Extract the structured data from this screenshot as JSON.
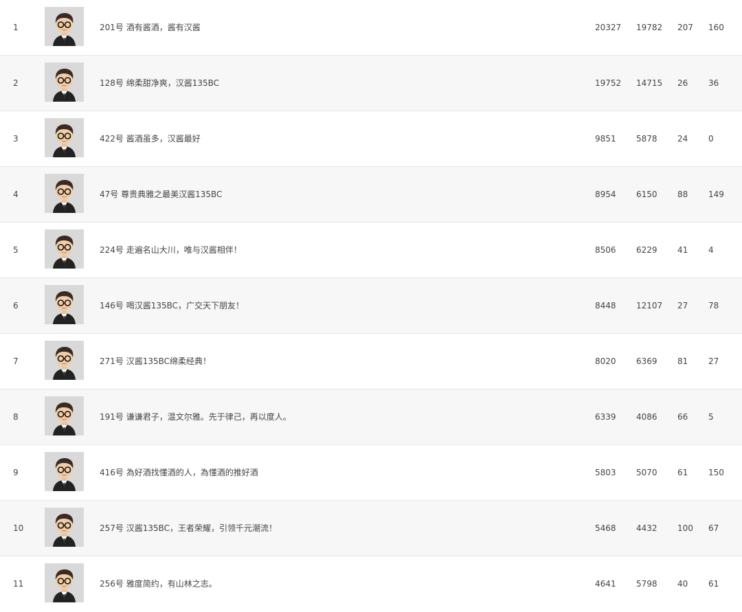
{
  "rows": [
    {
      "rank": "1",
      "title": "201号 酒有酱酒，酱有汉酱",
      "c1": "20327",
      "c2": "19782",
      "c3": "207",
      "c4": "160"
    },
    {
      "rank": "2",
      "title": "128号 绵柔甜净爽，汉酱135BC",
      "c1": "19752",
      "c2": "14715",
      "c3": "26",
      "c4": "36"
    },
    {
      "rank": "3",
      "title": "422号 酱酒虽多，汉酱最好",
      "c1": "9851",
      "c2": "5878",
      "c3": "24",
      "c4": "0"
    },
    {
      "rank": "4",
      "title": "47号 尊贵典雅之最美汉酱135BC",
      "c1": "8954",
      "c2": "6150",
      "c3": "88",
      "c4": "149"
    },
    {
      "rank": "5",
      "title": "224号 走遍名山大川，唯与汉酱相伴！",
      "c1": "8506",
      "c2": "6229",
      "c3": "41",
      "c4": "4"
    },
    {
      "rank": "6",
      "title": "146号 喝汉酱135BC，广交天下朋友！",
      "c1": "8448",
      "c2": "12107",
      "c3": "27",
      "c4": "78"
    },
    {
      "rank": "7",
      "title": "271号 汉酱135BC绵柔经典！",
      "c1": "8020",
      "c2": "6369",
      "c3": "81",
      "c4": "27"
    },
    {
      "rank": "8",
      "title": "191号 谦谦君子，温文尔雅。先于律己，再以度人。",
      "c1": "6339",
      "c2": "4086",
      "c3": "66",
      "c4": "5"
    },
    {
      "rank": "9",
      "title": "416号 為好酒找懂酒的人，為懂酒的推好酒",
      "c1": "5803",
      "c2": "5070",
      "c3": "61",
      "c4": "150"
    },
    {
      "rank": "10",
      "title": "257号 汉酱135BC，王者荣耀，引领千元潮流！",
      "c1": "5468",
      "c2": "4432",
      "c3": "100",
      "c4": "67"
    },
    {
      "rank": "11",
      "title": "256号 雅度简约，有山林之志。",
      "c1": "4641",
      "c2": "5798",
      "c3": "40",
      "c4": "61"
    }
  ],
  "avatar": {
    "icon": "user-avatar-icon"
  }
}
